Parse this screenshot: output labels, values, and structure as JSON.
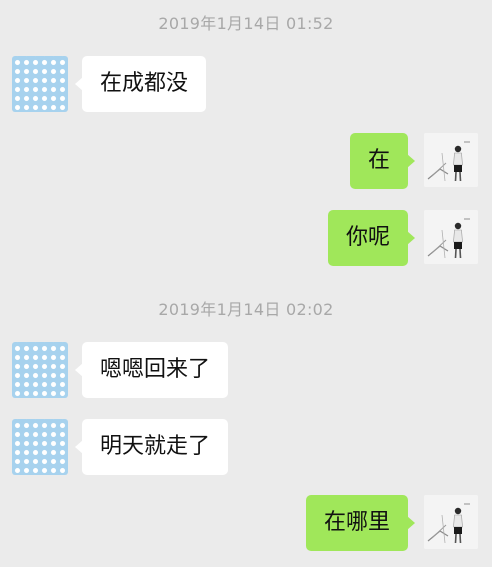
{
  "chat": {
    "timestamp_1": "2019年1月14日 01:52",
    "timestamp_2": "2019年1月14日 02:02",
    "messages": [
      {
        "side": "left",
        "text": "在成都没"
      },
      {
        "side": "right",
        "text": "在"
      },
      {
        "side": "right",
        "text": "你呢"
      },
      {
        "side": "left",
        "text": "嗯嗯回来了"
      },
      {
        "side": "left",
        "text": "明天就走了"
      },
      {
        "side": "right",
        "text": "在哪里"
      }
    ]
  },
  "icons": {
    "contact_avatar": "polka-dot-avatar-icon",
    "self_avatar": "person-photo-avatar-icon"
  },
  "colors": {
    "background": "#ebebeb",
    "incoming_bubble": "#ffffff",
    "outgoing_bubble": "#a0e75a",
    "timestamp_text": "#a8a8a8",
    "contact_avatar": "#a7d2ee"
  }
}
